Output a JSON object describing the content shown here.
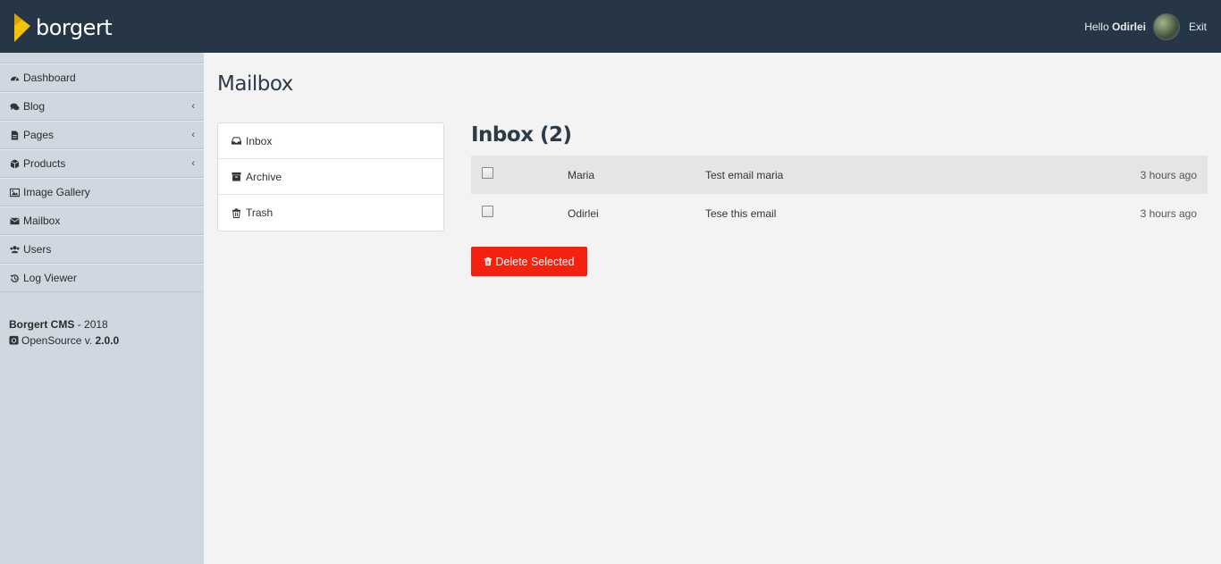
{
  "brand": {
    "name": "borgert",
    "accent": "#f4c20d"
  },
  "header": {
    "greeting_prefix": "Hello",
    "user_name": "Odirlei",
    "exit_label": "Exit"
  },
  "sidebar": {
    "items": [
      {
        "label": "Dashboard",
        "icon": "dashboard-icon",
        "has_children": false
      },
      {
        "label": "Blog",
        "icon": "comments-icon",
        "has_children": true
      },
      {
        "label": "Pages",
        "icon": "file-icon",
        "has_children": true
      },
      {
        "label": "Products",
        "icon": "cube-icon",
        "has_children": true
      },
      {
        "label": "Image Gallery",
        "icon": "image-icon",
        "has_children": false
      },
      {
        "label": "Mailbox",
        "icon": "envelope-icon",
        "has_children": false
      },
      {
        "label": "Users",
        "icon": "users-icon",
        "has_children": false
      },
      {
        "label": "Log Viewer",
        "icon": "history-icon",
        "has_children": false
      }
    ],
    "footer": {
      "app_name": "Borgert CMS",
      "year": "- 2018",
      "license_prefix": "OpenSource v.",
      "version": "2.0.0"
    }
  },
  "main": {
    "title": "Mailbox",
    "folders": [
      {
        "label": "Inbox",
        "icon": "inbox-icon"
      },
      {
        "label": "Archive",
        "icon": "archive-icon"
      },
      {
        "label": "Trash",
        "icon": "trash-icon"
      }
    ],
    "inbox_title": "Inbox (2)",
    "messages": [
      {
        "from": "Maria",
        "subject": "Test email maria",
        "time": "3 hours ago"
      },
      {
        "from": "Odirlei",
        "subject": "Tese this email",
        "time": "3 hours ago"
      }
    ],
    "delete_label": "Delete Selected",
    "delete_color": "#f6200e"
  }
}
